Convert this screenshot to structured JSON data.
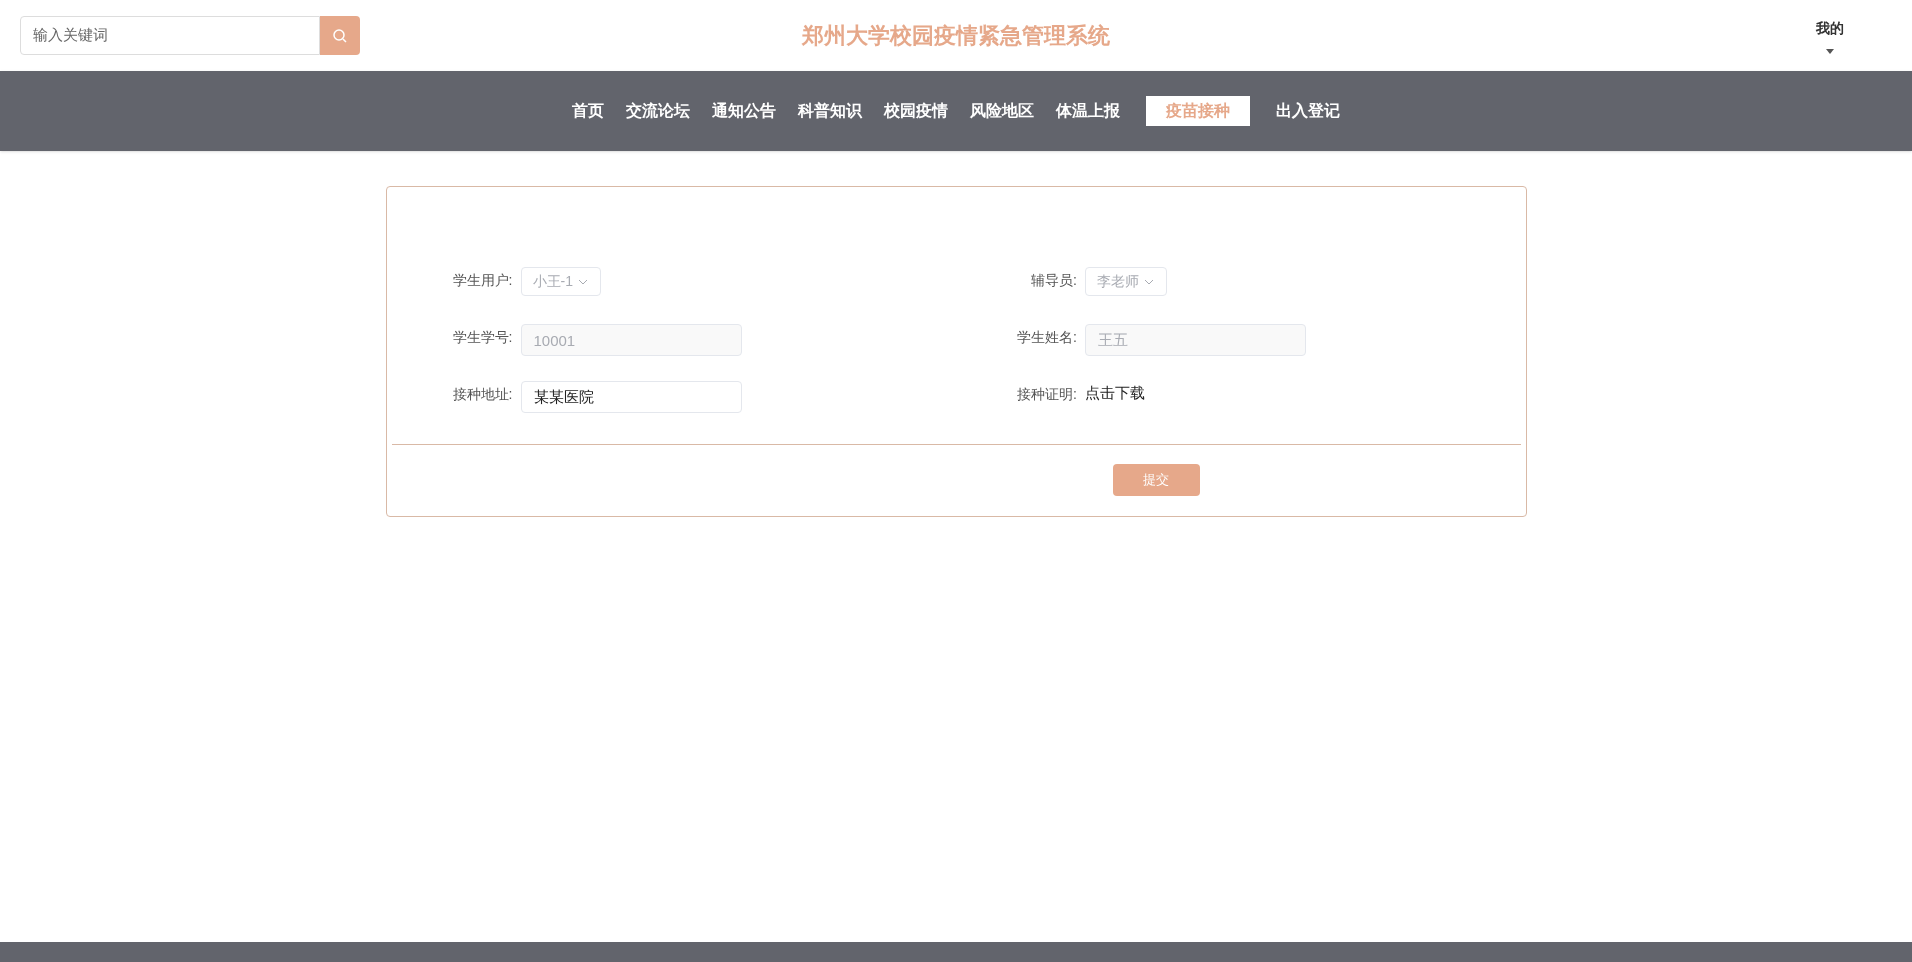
{
  "search": {
    "placeholder": "输入关键词"
  },
  "site_title": "郑州大学校园疫情紧急管理系统",
  "user_menu": {
    "label": "我的"
  },
  "nav": [
    {
      "label": "首页",
      "selected": false
    },
    {
      "label": "交流论坛",
      "selected": false
    },
    {
      "label": "通知公告",
      "selected": false
    },
    {
      "label": "科普知识",
      "selected": false
    },
    {
      "label": "校园疫情",
      "selected": false
    },
    {
      "label": "风险地区",
      "selected": false
    },
    {
      "label": "体温上报",
      "selected": false
    },
    {
      "label": "疫苗接种",
      "selected": true
    },
    {
      "label": "出入登记",
      "selected": false
    }
  ],
  "form": {
    "fields": [
      {
        "label": "学生用户:",
        "kind": "select",
        "value": "小王-1",
        "disabled": true
      },
      {
        "label": "辅导员:",
        "kind": "select",
        "value": "李老师",
        "disabled": true
      },
      {
        "label": "学生学号:",
        "kind": "input",
        "value": "10001",
        "disabled": true
      },
      {
        "label": "学生姓名:",
        "kind": "input",
        "value": "王五",
        "disabled": true
      },
      {
        "label": "接种地址:",
        "kind": "input",
        "value": "某某医院",
        "disabled": false
      },
      {
        "label": "接种证明:",
        "kind": "link",
        "value": "点击下载",
        "disabled": false
      }
    ],
    "submit": "提交"
  }
}
